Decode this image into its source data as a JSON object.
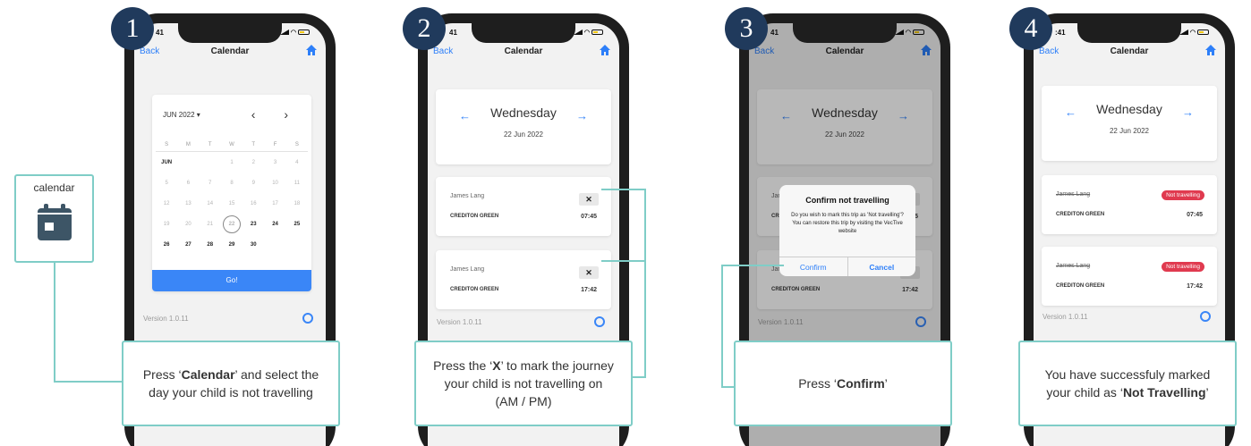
{
  "steps": [
    {
      "number": "1",
      "caption_pre": "Press ‘",
      "caption_bold": "Calendar",
      "caption_post": "’ and select the day your child is not travelling"
    },
    {
      "number": "2",
      "caption_pre": "Press the ‘",
      "caption_bold": "X",
      "caption_post": "’ to mark the journey your child is not travelling on (AM / PM)"
    },
    {
      "number": "3",
      "caption_pre": "Press ‘",
      "caption_bold": "Confirm",
      "caption_post": "’"
    },
    {
      "number": "4",
      "caption_pre": "You have successfuly marked your child as ‘",
      "caption_bold": "Not Travelling",
      "caption_post": "’"
    }
  ],
  "icon_box": {
    "label": "calendar"
  },
  "status": {
    "time_1": "41",
    "time_2": "41",
    "time_3": "41",
    "time_4": ":41"
  },
  "nav": {
    "back": "Back",
    "title": "Calendar"
  },
  "calendar": {
    "month_label": "JUN 2022 ▾",
    "arrows": "‹ ›",
    "dow": [
      "S",
      "M",
      "T",
      "W",
      "T",
      "F",
      "S"
    ],
    "weeks": [
      [
        "JUN",
        "",
        "",
        "1",
        "2",
        "3",
        "4"
      ],
      [
        "5",
        "6",
        "7",
        "8",
        "9",
        "10",
        "11"
      ],
      [
        "12",
        "13",
        "14",
        "15",
        "16",
        "17",
        "18"
      ],
      [
        "19",
        "20",
        "21",
        "22",
        "23",
        "24",
        "25"
      ],
      [
        "26",
        "27",
        "28",
        "29",
        "30",
        "",
        ""
      ]
    ],
    "selected_day": "22",
    "go_label": "Go!"
  },
  "day": {
    "weekday": "Wednesday",
    "date": "22 Jun 2022",
    "left_arrow": "←",
    "right_arrow": "→"
  },
  "trips": [
    {
      "name": "James Lang",
      "stop": "CREDITON GREEN",
      "time": "07:45"
    },
    {
      "name": "James Lang",
      "stop": "CREDITON GREEN",
      "time": "17:42"
    }
  ],
  "x_label": "✕",
  "not_travelling_badge": "Not travelling",
  "version": "Version 1.0.11",
  "dialog": {
    "title": "Confirm not travelling",
    "message": "Do you wish to mark this trip as 'Not travelling'? You can restore this trip by visiting the VecTive website",
    "confirm": "Confirm",
    "cancel": "Cancel"
  },
  "colors": {
    "badge": "#203a5c",
    "accent": "#3a86f7",
    "outline": "#7fcdc7",
    "not_travelling": "#e03a4f"
  }
}
